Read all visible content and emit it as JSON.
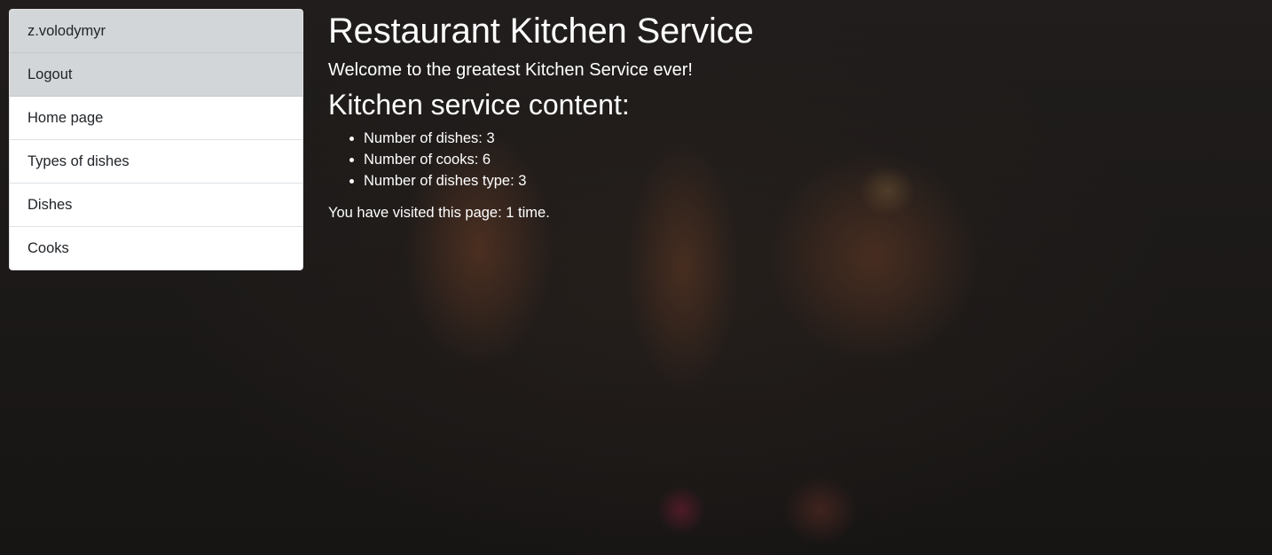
{
  "sidebar": {
    "items": [
      {
        "label": "z.volodymyr",
        "active": true
      },
      {
        "label": "Logout",
        "active": true
      },
      {
        "label": "Home page",
        "active": false
      },
      {
        "label": "Types of dishes",
        "active": false
      },
      {
        "label": "Dishes",
        "active": false
      },
      {
        "label": "Cooks",
        "active": false
      }
    ]
  },
  "main": {
    "title": "Restaurant Kitchen Service",
    "welcome": "Welcome to the greatest Kitchen Service ever!",
    "section_heading": "Kitchen service content:",
    "stats": [
      "Number of dishes: 3",
      "Number of cooks: 6",
      "Number of dishes type: 3"
    ],
    "visits": "You have visited this page: 1 time."
  },
  "colors": {
    "sidebar_active_bg": "#d3d6d8",
    "sidebar_bg": "#ffffff",
    "text_light": "#ffffff",
    "page_bg": "#1a1817"
  }
}
